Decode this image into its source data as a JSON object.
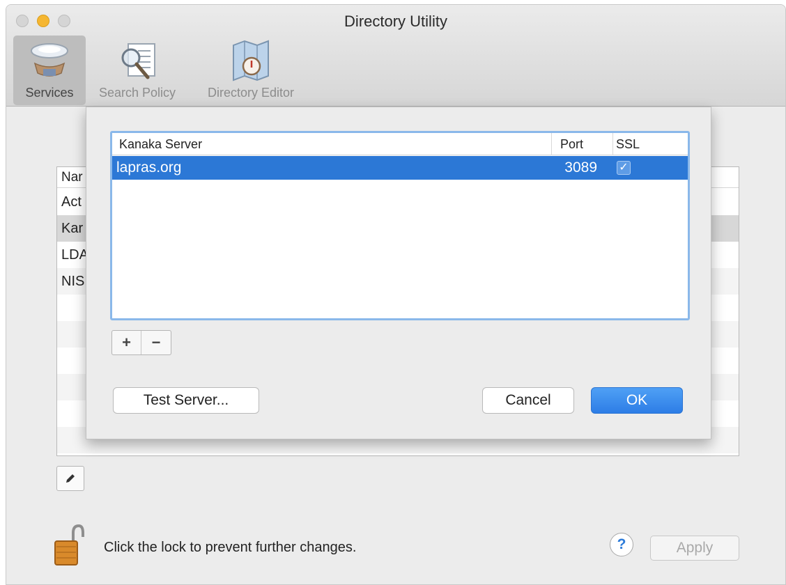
{
  "window": {
    "title": "Directory Utility"
  },
  "toolbar": {
    "services_label": "Services",
    "search_policy_label": "Search Policy",
    "directory_editor_label": "Directory Editor"
  },
  "background_list": {
    "header": "Nar",
    "rows": [
      "Act",
      "Kar",
      "LDA",
      "NIS"
    ]
  },
  "sheet": {
    "table": {
      "columns": [
        "Kanaka Server",
        "Port",
        "SSL"
      ],
      "rows": [
        {
          "server": "lapras.org",
          "port": "3089",
          "ssl_check": "✓"
        }
      ]
    },
    "add_label": "+",
    "remove_label": "−",
    "test_server_label": "Test Server...",
    "cancel_label": "Cancel",
    "ok_label": "OK"
  },
  "footer": {
    "lock_message": "Click the lock to prevent further changes.",
    "help_label": "?",
    "apply_label": "Apply"
  },
  "colors": {
    "selection": "#2c78d6",
    "accent_button": "#2d7de6",
    "focus_ring": "#8ab8ea"
  }
}
